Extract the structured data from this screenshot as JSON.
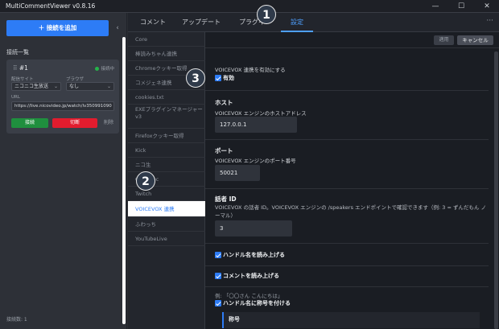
{
  "window": {
    "title": "MultiCommentViewer v0.8.16",
    "minimize_glyph": "—",
    "maximize_glyph": "☐",
    "close_glyph": "✕"
  },
  "left": {
    "add_button": "＋ 接続を追加",
    "collapse_glyph": "‹",
    "section_label": "接続一覧",
    "connection": {
      "number": "#1",
      "status": "接続中",
      "site_label": "配信サイト",
      "site_value": "ニコニコ生放送",
      "browser_label": "ブラウザ",
      "browser_value": "なし",
      "url_label": "URL",
      "url_value": "https://live.nicovideo.jp/watch/lv350991090",
      "connect": "接続",
      "disconnect": "切断",
      "delete": "削除"
    },
    "connection_count": "接続数: 1"
  },
  "tabs": [
    {
      "label": "コメント"
    },
    {
      "label": "アップデート"
    },
    {
      "label": "プラグイン"
    },
    {
      "label": "設定"
    }
  ],
  "more_glyph": "···",
  "nav_items": [
    {
      "label": "Core"
    },
    {
      "label": "棒読みちゃん連携"
    },
    {
      "label": "Chromeクッキー取得"
    },
    {
      "label": "コメジェネ連携"
    },
    {
      "label": "cookies.txt"
    },
    {
      "label": "EXEプラグインマネージャー v3"
    },
    {
      "label": "Firefoxクッキー取得"
    },
    {
      "label": "Kick"
    },
    {
      "label": "ニコ生"
    },
    {
      "label": "OpenRec"
    },
    {
      "label": "Twitch"
    },
    {
      "label": "VOICEVOX 連携"
    },
    {
      "label": "ふわっち"
    },
    {
      "label": "YouTubeLive"
    }
  ],
  "actions": {
    "apply": "適用",
    "cancel": "キャンセル"
  },
  "settings": {
    "enable_label": "VOICEVOX 連携を有効にする",
    "enable_check": "有効",
    "host_head": "ホスト",
    "host_desc": "VOICEVOX エンジンのホストアドレス",
    "host_value": "127.0.0.1",
    "port_head": "ポート",
    "port_desc": "VOICEVOX エンジンのポート番号",
    "port_value": "50021",
    "speaker_head": "話者 ID",
    "speaker_desc": "VOICEVOX の話者 ID。VOICEVOX エンジンの /speakers エンドポイントで確認できます（例: 3 = ずんだもん ノーマル）",
    "speaker_value": "3",
    "read_handle": "ハンドル名を読み上げる",
    "read_comment": "コメントを読み上げる",
    "example": "例: 「〇〇さん こんにちは」",
    "honorific": "ハンドル名に称号を付ける",
    "honorific_box": "称号"
  },
  "badges": [
    "1",
    "2",
    "3"
  ]
}
